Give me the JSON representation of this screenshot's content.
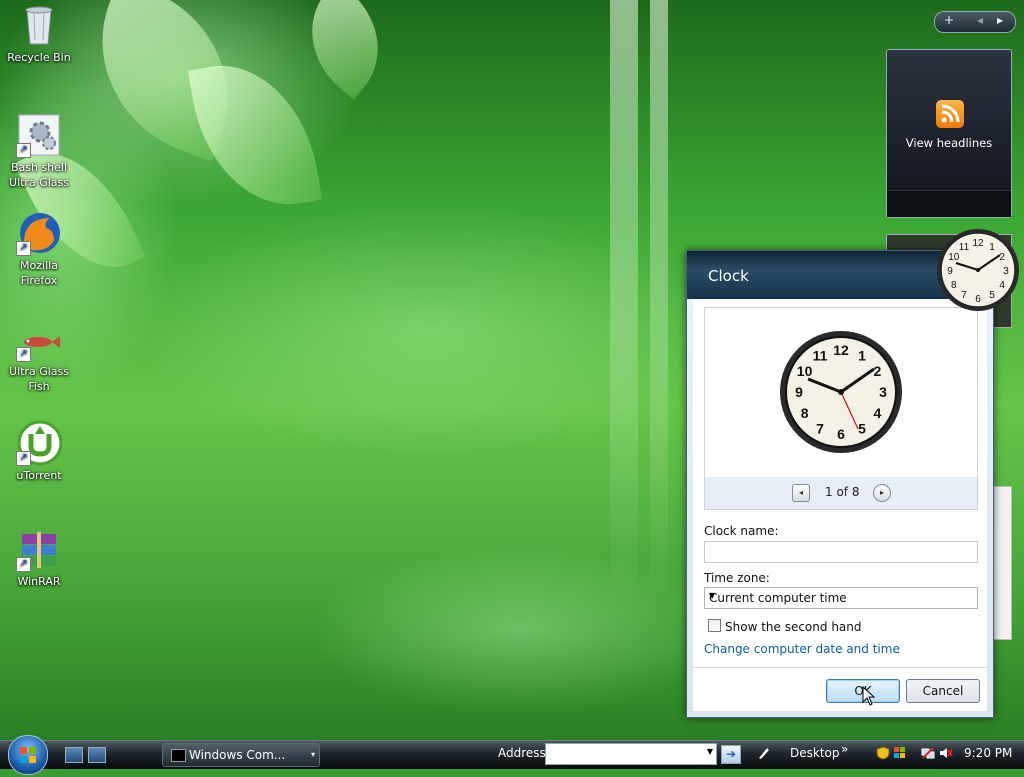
{
  "desktop": {
    "icons": [
      {
        "label": "Recycle Bin"
      },
      {
        "label": "Bash shell Ultra Glass"
      },
      {
        "label": "Mozilla Firefox"
      },
      {
        "label": "Ultra Glass Fish"
      },
      {
        "label": "uTorrent"
      },
      {
        "label": "WinRAR"
      }
    ]
  },
  "sidebar": {
    "add_glyph": "+",
    "prev_glyph": "◂",
    "next_glyph": "▸",
    "rss_gadget": {
      "label": "View headlines",
      "icon": "rss-icon"
    },
    "clock_gadget": {
      "icon": "clock-gadget-icon"
    }
  },
  "clock_dialog": {
    "title": "Clock",
    "pager": {
      "text": "1 of 8",
      "prev_icon": "◂",
      "next_icon": "▸"
    },
    "clock_name_label": "Clock name:",
    "clock_name_value": "",
    "time_zone_label": "Time zone:",
    "time_zone_value": "Current computer time",
    "show_second_hand_label": "Show the second hand",
    "show_second_hand_checked": false,
    "change_link": "Change computer date and time",
    "ok_label": "OK",
    "cancel_label": "Cancel",
    "clock_numerals": [
      "12",
      "1",
      "2",
      "3",
      "4",
      "5",
      "6",
      "7",
      "8",
      "9",
      "10",
      "11"
    ]
  },
  "taskbar": {
    "task_item": {
      "label": "Windows Com..."
    },
    "task_dropdown": "▾",
    "address_label": "Address",
    "address_value": "",
    "go_glyph": "➔",
    "desktop_toolbar_label": "Desktop",
    "toolbar_chevron": "»",
    "clock_time": "9:20 PM"
  },
  "colors": {
    "accent": "#0b5fb4",
    "taskbar": "#1d252b",
    "dialog_title": "#14324a"
  }
}
